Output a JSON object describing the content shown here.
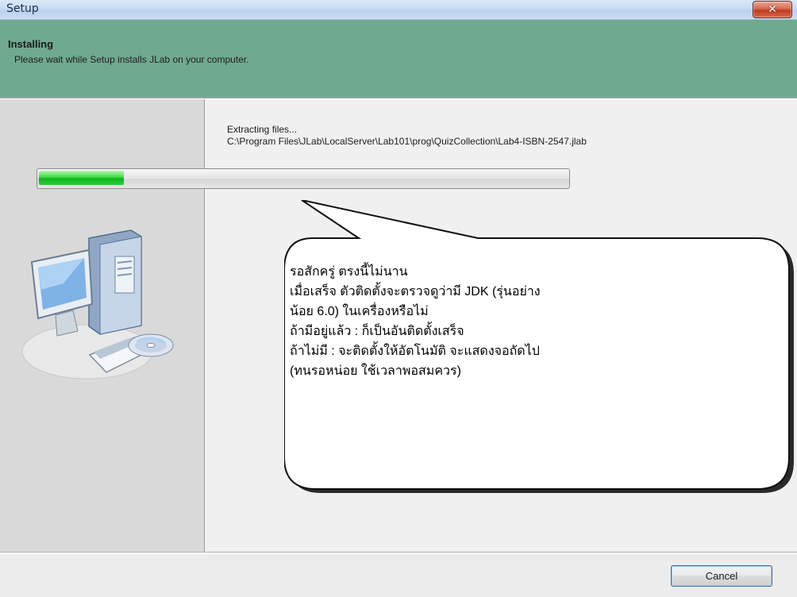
{
  "window": {
    "title": "Setup",
    "close_icon": "close-icon"
  },
  "header": {
    "title": "Installing",
    "subtitle": "Please wait while Setup installs JLab on your computer."
  },
  "install": {
    "status": "Extracting files...",
    "file_path": "C:\\Program Files\\JLab\\LocalServer\\Lab101\\prog\\QuizCollection\\Lab4-ISBN-2547.jlab",
    "progress_fraction": 0.16
  },
  "callout": {
    "lines": [
      "รอสักครู่ ตรงนี้ไม่นาน",
      "เมื่อเสร็จ ตัวติดตั้งจะตรวจดูว่ามี JDK (รุ่นอย่าง",
      "น้อย 6.0) ในเครื่องหรือไม่",
      "ถ้ามีอยู่แล้ว : ก็เป็นอันติดตั้งเสร็จ",
      "ถ้าไม่มี : จะติดตั้งให้อัตโนมัติ จะแสดงจอถัดไป",
      "(ทนรอหน่อย ใช้เวลาพอสมควร)"
    ]
  },
  "footer": {
    "cancel_label": "Cancel"
  },
  "colors": {
    "header_bg": "#6fa98f",
    "progress_green": "#0db51a",
    "close_red": "#c23a1e"
  }
}
